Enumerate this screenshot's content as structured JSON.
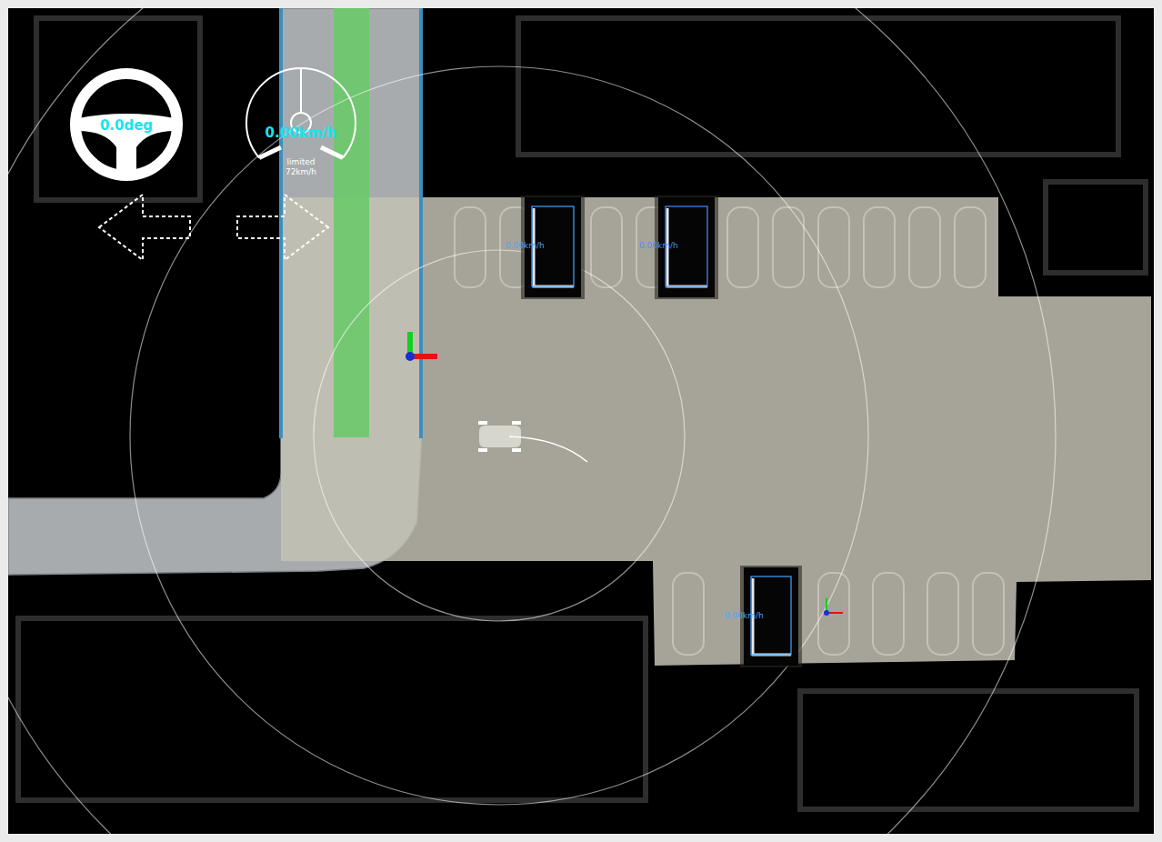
{
  "hud": {
    "steering": {
      "reading": "0.0deg"
    },
    "speed": {
      "reading": "0.00km/h",
      "limit_label": "limited",
      "limit": "72km/h",
      "level": 0
    },
    "turn_signals": [
      {
        "direction": "left",
        "on": false
      },
      {
        "direction": "right",
        "on": false
      }
    ]
  },
  "objects": [
    {
      "label": "0.00km/h",
      "color": "#4aa3ff"
    },
    {
      "label": "0.00km/h",
      "color": "#4a8cff"
    },
    {
      "label": "0.00km/h",
      "color": "#4aa3ff"
    }
  ]
}
